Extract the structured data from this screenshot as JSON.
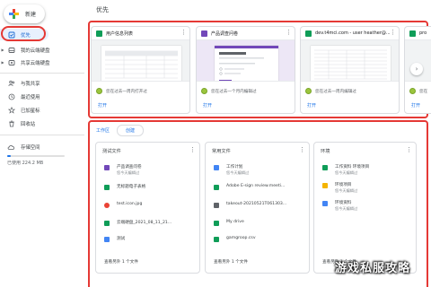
{
  "sidebar": {
    "new_label": "新建",
    "items": [
      {
        "label": "优先",
        "icon": "check-square-icon"
      },
      {
        "label": "我的云端硬盘",
        "icon": "drive-icon"
      },
      {
        "label": "共享云端硬盘",
        "icon": "shared-drive-icon"
      },
      {
        "label": "与我共享",
        "icon": "people-icon"
      },
      {
        "label": "最近使用",
        "icon": "clock-icon"
      },
      {
        "label": "已加星标",
        "icon": "star-icon"
      },
      {
        "label": "回收站",
        "icon": "trash-icon"
      },
      {
        "label": "存储空间",
        "icon": "cloud-icon"
      }
    ],
    "storage_used": "已使用 224.2 MB",
    "storage_fraction": 0.06
  },
  "main": {
    "title": "优先",
    "suggested": [
      {
        "name": "用户信息列表",
        "type": "sheets",
        "activity": "您在过去一周内打开过",
        "open": "打开"
      },
      {
        "name": "产品调查问卷",
        "type": "forms",
        "activity": "您在过去一个月内编辑过",
        "open": "打开"
      },
      {
        "name": "dev.t4mci.com - user heather@...",
        "type": "sheets",
        "activity": "您在过去一周内编辑过",
        "open": "打开"
      },
      {
        "name": "pro",
        "type": "sheets",
        "activity": "您在",
        "open": "打开"
      }
    ],
    "tabs": {
      "workspace": "工作区",
      "create": "创建"
    },
    "workspaces": [
      {
        "title": "测试文件",
        "files": [
          {
            "name": "产品调查问卷",
            "sub": "您今天编辑过",
            "type": "forms"
          },
          {
            "name": "无标题电子表格",
            "sub": "",
            "type": "sheets"
          },
          {
            "name": "test.icon.jpg",
            "sub": "",
            "type": "image"
          },
          {
            "name": "云端硬盘_2021_08_11_21...",
            "sub": "",
            "type": "sheets"
          },
          {
            "name": "测试",
            "sub": "",
            "type": "docs"
          }
        ],
        "more": "查看另外 1 个文件"
      },
      {
        "title": "常用文件",
        "files": [
          {
            "name": "工作计划",
            "sub": "您今天编辑过",
            "type": "docs"
          },
          {
            "name": "Adobe E-sign review.meeti...",
            "sub": "",
            "type": "sheets"
          },
          {
            "name": "takeout-20210521T061303...",
            "sub": "",
            "type": "zip"
          },
          {
            "name": "My drive",
            "sub": "",
            "type": "sheets"
          },
          {
            "name": "gamgroop.csv",
            "sub": "",
            "type": "sheets"
          }
        ],
        "more": "查看另外 1 个文件"
      },
      {
        "title": "环境",
        "files": [
          {
            "name": "工作资料 环境项目",
            "sub": "您今天编辑过",
            "type": "sheets"
          },
          {
            "name": "环境项目",
            "sub": "您今天编辑过",
            "type": "slides"
          },
          {
            "name": "环境资料",
            "sub": "您今天编辑过",
            "type": "docs"
          }
        ],
        "more": "查看另外 1 个文件"
      }
    ]
  },
  "watermark": "游戏私服攻略",
  "colors": {
    "sheets": "#0f9d58",
    "forms": "#7248b9",
    "docs": "#4285f4",
    "slides": "#f4b400",
    "zip": "#5f6368",
    "image": "#ea4335",
    "highlight": "#e53935",
    "accent": "#1a73e8"
  }
}
